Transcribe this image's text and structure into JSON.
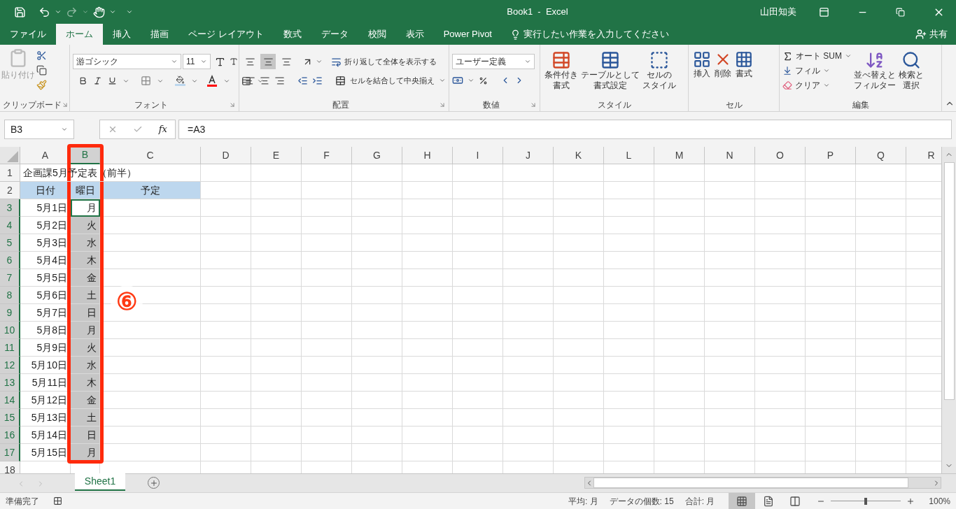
{
  "window": {
    "title": "Book1  -  Excel",
    "user": "山田知美"
  },
  "ribbon_tabs": [
    {
      "label": "ファイル",
      "selected": false
    },
    {
      "label": "ホーム",
      "selected": true
    },
    {
      "label": "挿入",
      "selected": false
    },
    {
      "label": "描画",
      "selected": false
    },
    {
      "label": "ページ レイアウト",
      "selected": false
    },
    {
      "label": "数式",
      "selected": false
    },
    {
      "label": "データ",
      "selected": false
    },
    {
      "label": "校閲",
      "selected": false
    },
    {
      "label": "表示",
      "selected": false
    },
    {
      "label": "Power Pivot",
      "selected": false
    }
  ],
  "tell_me": "実行したい作業を入力してください",
  "share": "共有",
  "ribbon": {
    "clipboard": {
      "label": "クリップボード",
      "paste": "貼り付け"
    },
    "font": {
      "label": "フォント",
      "name": "游ゴシック",
      "size": "11"
    },
    "alignment": {
      "label": "配置",
      "wrap": "折り返して全体を表示する",
      "merge": "セルを結合して中央揃え",
      "vertical_align": [
        {
          "selected": false
        },
        {
          "selected": true
        },
        {
          "selected": false
        }
      ]
    },
    "number": {
      "label": "数値",
      "format": "ユーザー定義"
    },
    "styles": {
      "label": "スタイル",
      "buttons": [
        {
          "lines": [
            "条件付き",
            "書式"
          ]
        },
        {
          "lines": [
            "テーブルとして",
            "書式設定"
          ]
        },
        {
          "lines": [
            "セルの",
            "スタイル"
          ]
        }
      ]
    },
    "cells": {
      "label": "セル",
      "buttons": [
        "挿入",
        "削除",
        "書式"
      ]
    },
    "editing": {
      "label": "編集",
      "autosum": "オート SUM",
      "fill": "フィル",
      "clear": "クリア",
      "buttons": [
        {
          "lines": [
            "並べ替えと",
            "フィルター"
          ]
        },
        {
          "lines": [
            "検索と",
            "選択"
          ]
        }
      ]
    }
  },
  "formula_bar": {
    "name_box": "B3",
    "function_button": "fx",
    "formula": "=A3"
  },
  "columns": [
    {
      "label": "A",
      "selected": false
    },
    {
      "label": "B",
      "selected": true
    },
    {
      "label": "C",
      "selected": false
    },
    {
      "label": "D",
      "selected": false
    },
    {
      "label": "E",
      "selected": false
    },
    {
      "label": "F",
      "selected": false
    },
    {
      "label": "G",
      "selected": false
    },
    {
      "label": "H",
      "selected": false
    },
    {
      "label": "I",
      "selected": false
    },
    {
      "label": "J",
      "selected": false
    },
    {
      "label": "K",
      "selected": false
    },
    {
      "label": "L",
      "selected": false
    },
    {
      "label": "M",
      "selected": false
    },
    {
      "label": "N",
      "selected": false
    },
    {
      "label": "O",
      "selected": false
    },
    {
      "label": "P",
      "selected": false
    },
    {
      "label": "Q",
      "selected": false
    },
    {
      "label": "R",
      "selected": false
    }
  ],
  "rows": [
    {
      "number": "1",
      "kind": "title",
      "selected": false,
      "title": "企画課5月予定表（前半）"
    },
    {
      "number": "2",
      "kind": "header",
      "selected": false,
      "date": "日付",
      "weekday": "曜日",
      "plan": "予定"
    },
    {
      "number": "3",
      "kind": "data",
      "selected": true,
      "active": true,
      "date": "5月1日",
      "weekday": "月"
    },
    {
      "number": "4",
      "kind": "data",
      "selected": true,
      "active": false,
      "date": "5月2日",
      "weekday": "火"
    },
    {
      "number": "5",
      "kind": "data",
      "selected": true,
      "active": false,
      "date": "5月3日",
      "weekday": "水"
    },
    {
      "number": "6",
      "kind": "data",
      "selected": true,
      "active": false,
      "date": "5月4日",
      "weekday": "木"
    },
    {
      "number": "7",
      "kind": "data",
      "selected": true,
      "active": false,
      "date": "5月5日",
      "weekday": "金"
    },
    {
      "number": "8",
      "kind": "data",
      "selected": true,
      "active": false,
      "date": "5月6日",
      "weekday": "土"
    },
    {
      "number": "9",
      "kind": "data",
      "selected": true,
      "active": false,
      "date": "5月7日",
      "weekday": "日"
    },
    {
      "number": "10",
      "kind": "data",
      "selected": true,
      "active": false,
      "date": "5月8日",
      "weekday": "月"
    },
    {
      "number": "11",
      "kind": "data",
      "selected": true,
      "active": false,
      "date": "5月9日",
      "weekday": "火"
    },
    {
      "number": "12",
      "kind": "data",
      "selected": true,
      "active": false,
      "date": "5月10日",
      "weekday": "水"
    },
    {
      "number": "13",
      "kind": "data",
      "selected": true,
      "active": false,
      "date": "5月11日",
      "weekday": "木"
    },
    {
      "number": "14",
      "kind": "data",
      "selected": true,
      "active": false,
      "date": "5月12日",
      "weekday": "金"
    },
    {
      "number": "15",
      "kind": "data",
      "selected": true,
      "active": false,
      "date": "5月13日",
      "weekday": "土"
    },
    {
      "number": "16",
      "kind": "data",
      "selected": true,
      "active": false,
      "date": "5月14日",
      "weekday": "日"
    },
    {
      "number": "17",
      "kind": "data",
      "selected": true,
      "active": false,
      "date": "5月15日",
      "weekday": "月"
    },
    {
      "number": "18",
      "kind": "empty",
      "selected": false
    }
  ],
  "annotation": {
    "marker": "⑥"
  },
  "sheet_tabs": [
    {
      "label": "Sheet1",
      "selected": true
    }
  ],
  "status_bar": {
    "state": "準備完了",
    "average": "平均: 月",
    "count": "データの個数: 15",
    "sum": "合計: 月",
    "views": [
      {
        "kind": "normal",
        "selected": true
      },
      {
        "kind": "page_layout",
        "selected": false
      },
      {
        "kind": "page_break",
        "selected": false
      }
    ],
    "zoom": {
      "level": 0.5,
      "reading": "100%"
    }
  }
}
